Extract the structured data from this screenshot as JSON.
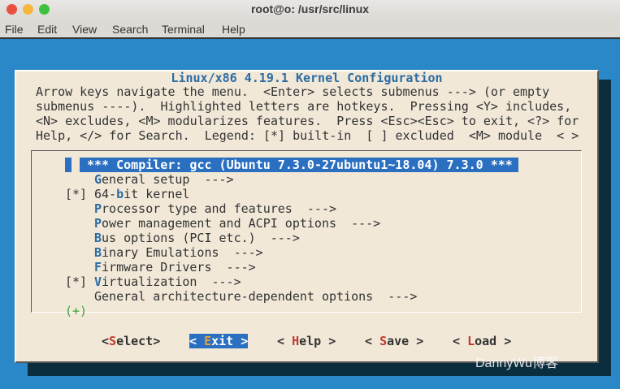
{
  "window": {
    "title": "root@o: /usr/src/linux",
    "controls": {
      "close": "#e9503f",
      "minimize": "#f5b83d",
      "maximize": "#3bc23e"
    }
  },
  "menubar": [
    "File",
    "Edit",
    "View",
    "Search",
    "Terminal",
    "Help"
  ],
  "dialog": {
    "title": "Linux/x86 4.19.1 Kernel Configuration",
    "help": [
      "Arrow keys navigate the menu.  <Enter> selects submenus ---> (or empty",
      "submenus ----).  Highlighted letters are hotkeys.  Pressing <Y> includes,",
      "<N> excludes, <M> modularizes features.  Press <Esc><Esc> to exit, <?> for",
      "Help, </> for Search.  Legend: [*] built-in  [ ] excluded  <M> module  < >"
    ],
    "items": [
      {
        "prefix": "",
        "pre": "",
        "hot": "",
        "post": "*** Compiler: gcc (Ubuntu 7.3.0-27ubuntu1~18.04) 7.3.0 ***",
        "selected": true
      },
      {
        "prefix": "",
        "pre": "",
        "hot": "G",
        "post": "eneral setup  --->"
      },
      {
        "prefix": "[*]",
        "pre": "64-",
        "hot": "b",
        "post": "it kernel"
      },
      {
        "prefix": "",
        "pre": "",
        "hot": "P",
        "post": "rocessor type and features  --->"
      },
      {
        "prefix": "",
        "pre": "",
        "hot": "P",
        "post": "ower management and ACPI options  --->"
      },
      {
        "prefix": "",
        "pre": "",
        "hot": "B",
        "post": "us options (PCI etc.)  --->"
      },
      {
        "prefix": "",
        "pre": "",
        "hot": "B",
        "post": "inary Emulations  --->"
      },
      {
        "prefix": "",
        "pre": "",
        "hot": "F",
        "post": "irmware Drivers  --->"
      },
      {
        "prefix": "[*]",
        "pre": "",
        "hot": "V",
        "post": "irtualization  --->"
      },
      {
        "prefix": "",
        "pre": "",
        "hot": "",
        "post": "General architecture-dependent options  --->"
      }
    ],
    "more": "(+)",
    "buttons": [
      {
        "pre": "<",
        "hot": "S",
        "post": "elect>"
      },
      {
        "pre": "< ",
        "hot": "E",
        "post": "xit >",
        "active": true
      },
      {
        "pre": "< ",
        "hot": "H",
        "post": "elp >"
      },
      {
        "pre": "< ",
        "hot": "S",
        "post": "ave >"
      },
      {
        "pre": "< ",
        "hot": "L",
        "post": "oad >"
      }
    ]
  },
  "watermark": "DannyWu博客"
}
